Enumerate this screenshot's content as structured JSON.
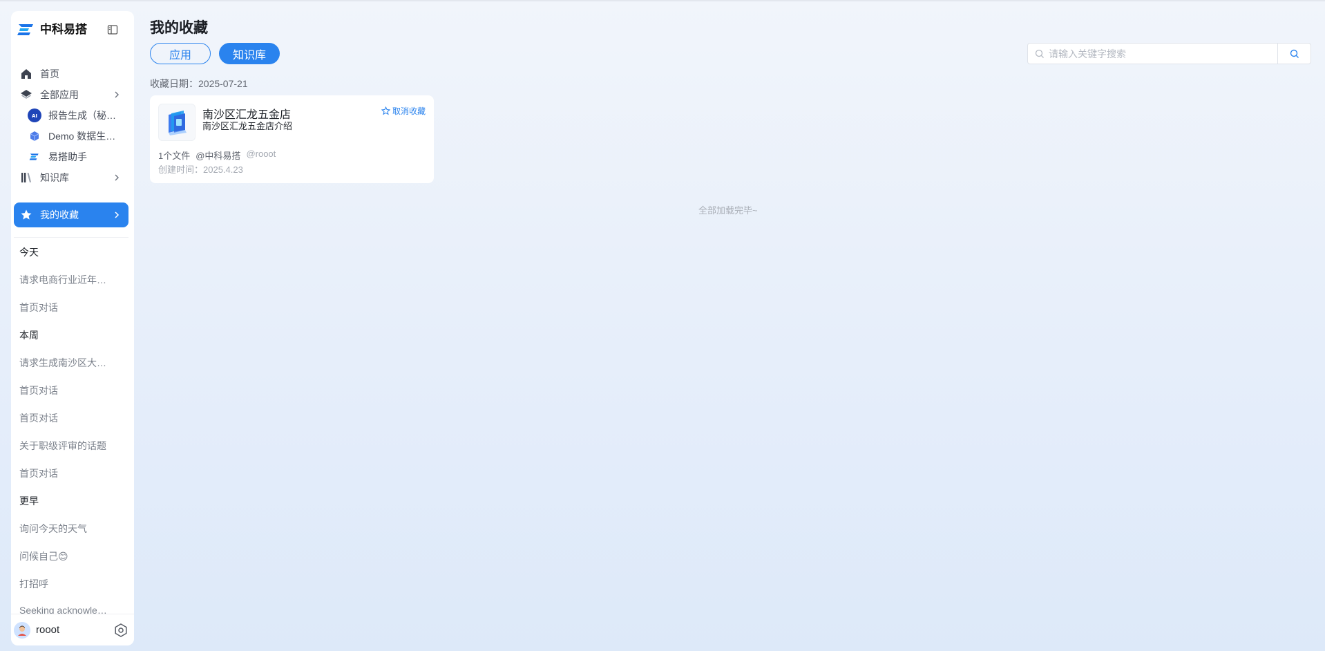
{
  "brand": {
    "name": "中科易搭"
  },
  "nav": {
    "home": "首页",
    "all_apps": "全部应用",
    "apps": [
      {
        "label": "报告生成（秘…",
        "icon": "ai-report-icon"
      },
      {
        "label": "Demo 数据生…",
        "icon": "cube-icon"
      },
      {
        "label": "易搭助手",
        "icon": "brand-icon"
      }
    ],
    "knowledge": "知识库",
    "favorites": "我的收藏"
  },
  "history": {
    "today_label": "今天",
    "today": [
      "请求电商行业近年…",
      "首页对话"
    ],
    "week_label": "本周",
    "week": [
      "请求生成南沙区大…",
      "首页对话",
      "首页对话",
      "关于职级评审的话题",
      "首页对话"
    ],
    "earlier_label": "更早",
    "earlier": [
      "询问今天的天气",
      "问候自己😊",
      "打招呼",
      "Seeking acknowle…"
    ]
  },
  "user": {
    "name": "rooot"
  },
  "main": {
    "title": "我的收藏",
    "tab_app": "应用",
    "tab_kb": "知识库",
    "search_placeholder": "请输入关键字搜索",
    "fav_date": "收藏日期：2025-07-21",
    "card": {
      "title": "南沙区汇龙五金店",
      "desc": "南沙区汇龙五金店介绍",
      "unfav": "取消收藏",
      "files": "1个文件",
      "owner": "@中科易搭",
      "creator": "@rooot",
      "created": "创建时间：2025.4.23"
    },
    "loaded_all": "全部加载完毕~"
  },
  "colors": {
    "accent": "#2a83ee",
    "bg": "#eaf1fb"
  }
}
